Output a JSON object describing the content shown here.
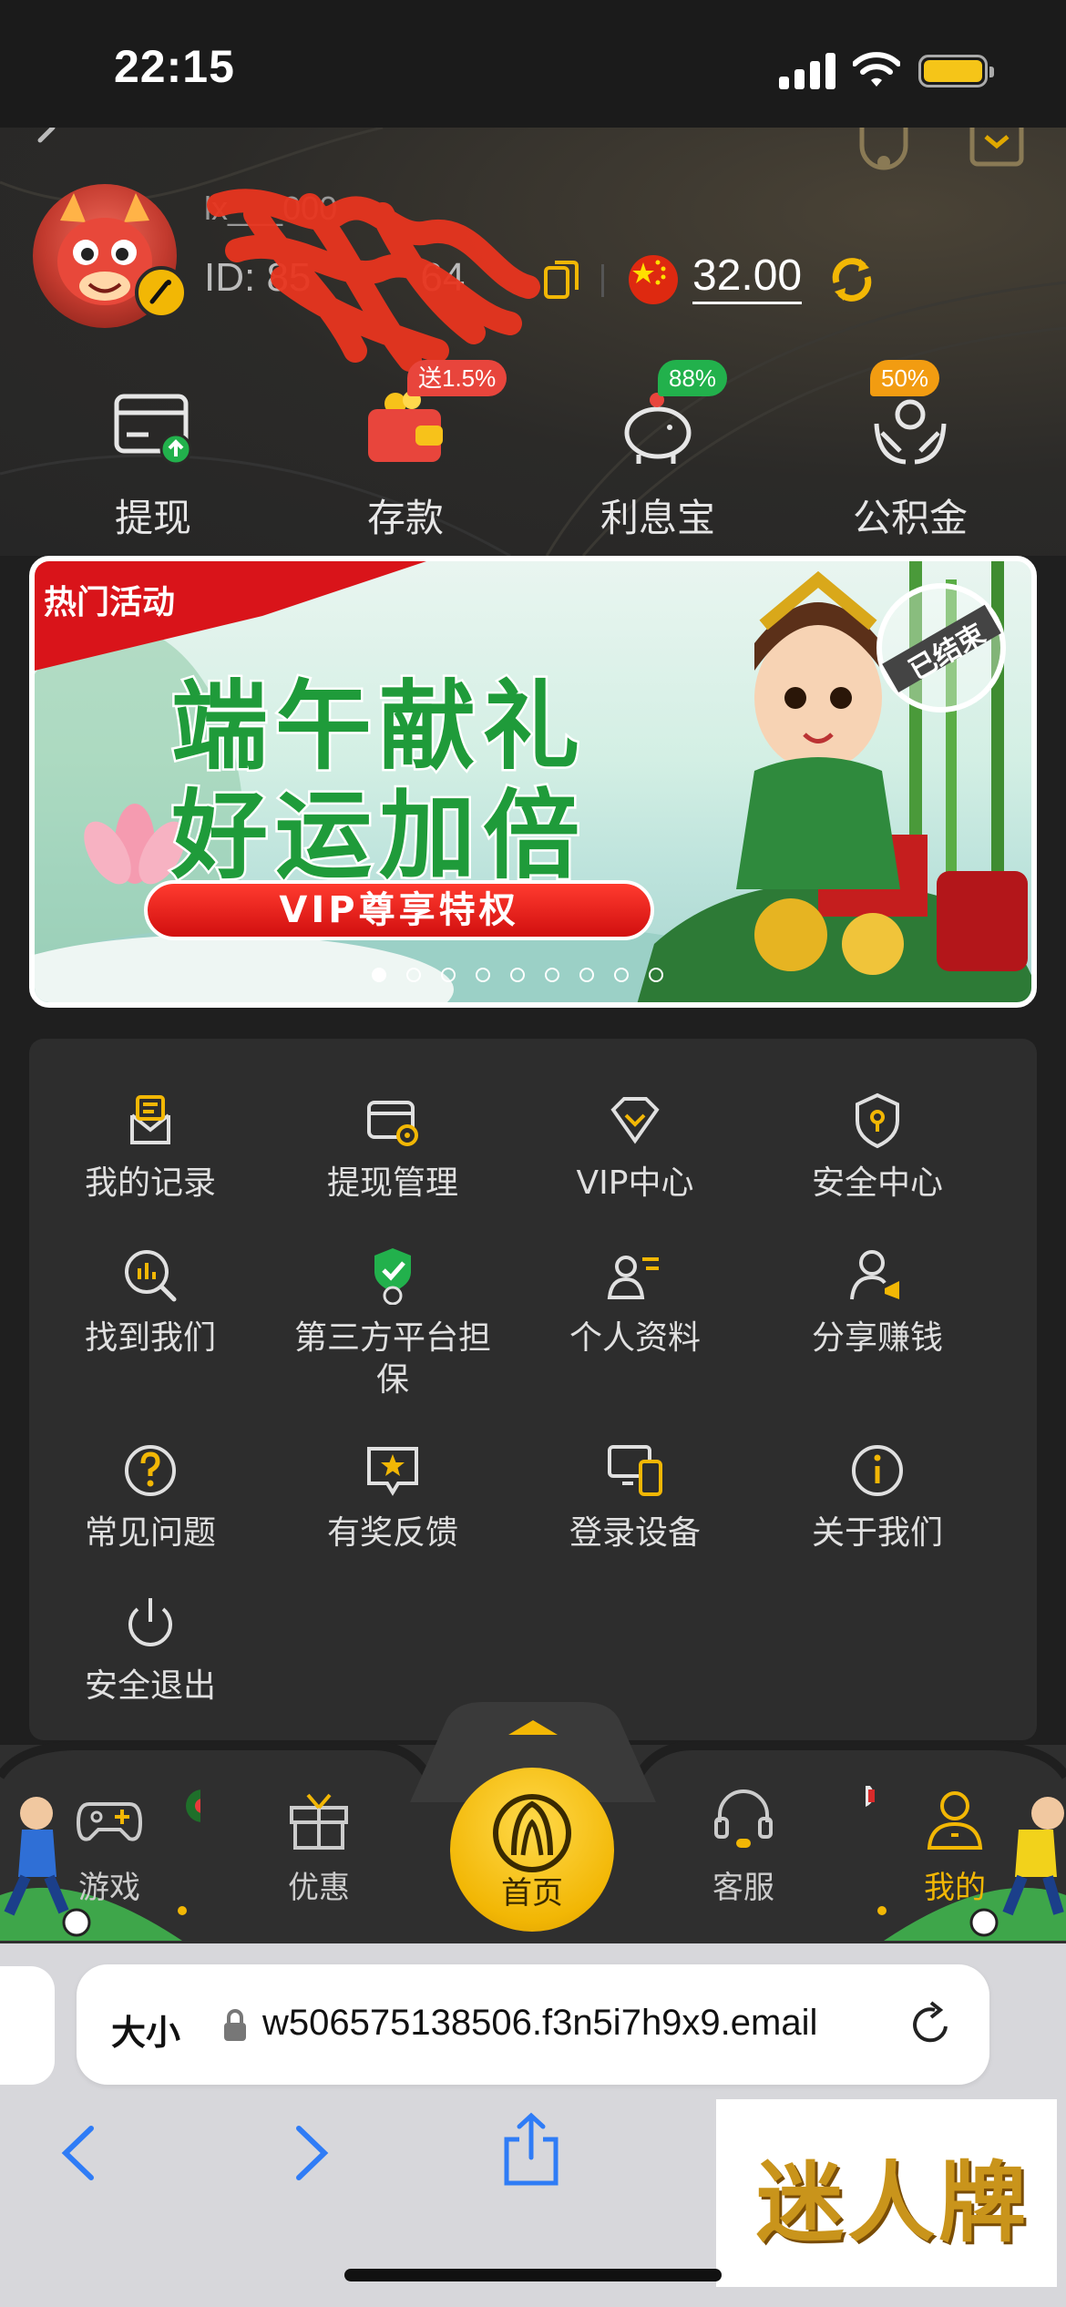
{
  "status_bar": {
    "time": "22:15"
  },
  "profile": {
    "username": "lx___000",
    "id_label": "ID: 85",
    "id_value_tail": "64",
    "balance": "32.00"
  },
  "quick_actions": [
    {
      "label": "提现",
      "badge": "",
      "icon": "withdraw-card-icon"
    },
    {
      "label": "存款",
      "badge": "送1.5%",
      "badge_color": "#e8453c",
      "icon": "wallet-icon"
    },
    {
      "label": "利息宝",
      "badge": "88%",
      "badge_color": "#22b14c",
      "icon": "piggy-bank-icon"
    },
    {
      "label": "公积金",
      "badge": "50%",
      "badge_color": "#f29c11",
      "icon": "hands-coin-icon"
    }
  ],
  "banner": {
    "tag": "热门活动",
    "line1": "端午献礼",
    "line2": "好运加倍",
    "pill": "VIP尊享特权",
    "stamp": "已结束"
  },
  "menu": [
    {
      "label": "我的记录",
      "icon": "records-icon"
    },
    {
      "label": "提现管理",
      "icon": "withdraw-manage-icon"
    },
    {
      "label": "VIP中心",
      "icon": "vip-diamond-icon"
    },
    {
      "label": "安全中心",
      "icon": "shield-icon"
    },
    {
      "label": "找到我们",
      "icon": "search-chart-icon"
    },
    {
      "label": "第三方平台担保",
      "icon": "verified-shield-icon"
    },
    {
      "label": "个人资料",
      "icon": "profile-card-icon"
    },
    {
      "label": "分享赚钱",
      "icon": "share-user-icon"
    },
    {
      "label": "常见问题",
      "icon": "question-icon"
    },
    {
      "label": "有奖反馈",
      "icon": "feedback-star-icon"
    },
    {
      "label": "登录设备",
      "icon": "devices-icon"
    },
    {
      "label": "关于我们",
      "icon": "info-icon"
    },
    {
      "label": "安全退出",
      "icon": "power-icon"
    }
  ],
  "tabbar": {
    "game": "游戏",
    "promo": "优惠",
    "home": "首页",
    "service": "客服",
    "mine": "我的",
    "active_color": "#f2b705"
  },
  "safari": {
    "aa": "大小",
    "url": "w506575138506.f3n5i7h9x9.email"
  },
  "watermark": "迷人牌",
  "colors": {
    "accent": "#f2b705",
    "background": "#1f1f1f",
    "card": "#2d2d2d"
  }
}
